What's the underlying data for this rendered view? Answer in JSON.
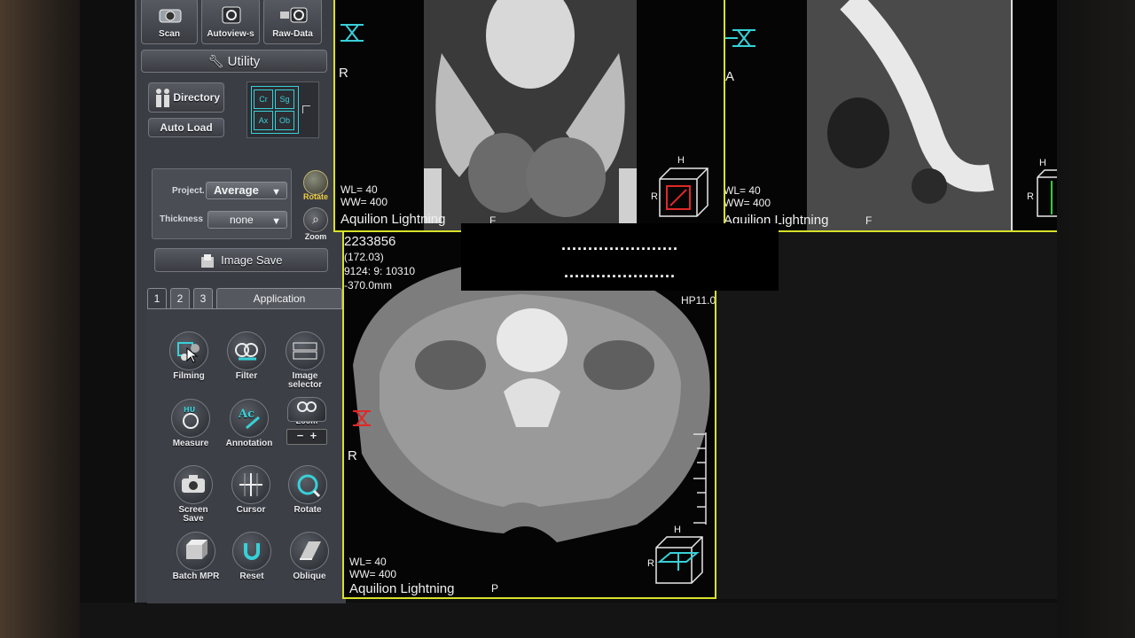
{
  "toolbar_top": {
    "scan": "Scan",
    "autoview": "Autoview-s",
    "rawdata": "Raw-Data"
  },
  "utility": {
    "label": "Utility"
  },
  "directory": {
    "label": "Directory",
    "autoload": "Auto Load"
  },
  "orientations": [
    "Cr",
    "Sg",
    "Ax",
    "Ob"
  ],
  "projection": {
    "label": "Project.",
    "value": "Average",
    "thickness_label": "Thickness",
    "thickness_value": "none",
    "rotate": "Rotate",
    "zoom": "Zoom"
  },
  "image_save": "Image Save",
  "tabs": [
    "1",
    "2",
    "3",
    "Application"
  ],
  "tools": [
    {
      "label": "Filming",
      "icon": "filming-icon"
    },
    {
      "label": "Filter",
      "icon": "filter-icon"
    },
    {
      "label": "Image selector",
      "icon": "image-selector-icon"
    },
    {
      "label": "Measure",
      "icon": "measure-icon"
    },
    {
      "label": "Annotation",
      "icon": "annotation-icon"
    },
    {
      "label": "Zoom",
      "icon": "zoom-icon"
    },
    {
      "label": "Screen Save",
      "icon": "camera-icon"
    },
    {
      "label": "Cursor",
      "icon": "cursor-icon"
    },
    {
      "label": "Rotate",
      "icon": "rotate-icon"
    },
    {
      "label": "Batch MPR",
      "icon": "batch-mpr-icon"
    },
    {
      "label": "Reset",
      "icon": "reset-icon"
    },
    {
      "label": "Oblique",
      "icon": "oblique-icon"
    }
  ],
  "zoom_ctrl": {
    "minus": "−",
    "plus": "+",
    "label": "Zoom"
  },
  "viewports": {
    "coronal": {
      "side": "R",
      "wl": "WL= 40",
      "ww": "WW= 400",
      "scanner": "Aquilion Lightning",
      "bottom": "F",
      "cube_top": "H",
      "cube_left": "R"
    },
    "sagittal": {
      "side": "A",
      "wl": "WL= 40",
      "ww": "WW= 400",
      "scanner": "Aquilion Lightning",
      "bottom": "F",
      "cube_top": "H",
      "cube_left": "R"
    },
    "axial": {
      "id": "2233856",
      "l2": "(172.03)",
      "l3": "9124: 9: 10310",
      "l4": "-370.0mm",
      "filter": "HP11.0",
      "side": "R",
      "wl": "WL= 40",
      "ww": "WW= 400",
      "scanner": "Aquilion Lightning",
      "bottom": "P",
      "cube_top": "H",
      "cube_left": "R"
    }
  },
  "redaction": {
    "line1": "......................",
    "line2": "....................."
  },
  "colors": {
    "viewport_border": "#d8e12a",
    "accent": "#38d0d8",
    "panel": "#3b3d44"
  }
}
